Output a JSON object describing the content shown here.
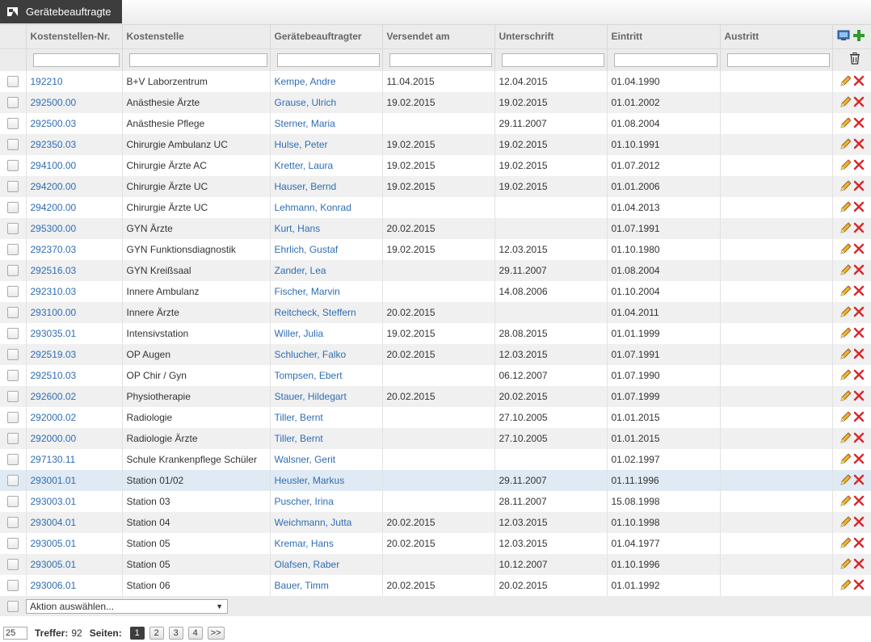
{
  "tab": {
    "label": "Gerätebeauftragte"
  },
  "columns": [
    "Kostenstellen-Nr.",
    "Kostenstelle",
    "Gerätebeauftragter",
    "Versendet am",
    "Unterschrift",
    "Eintritt",
    "Austritt"
  ],
  "rows": [
    {
      "nr": "192210",
      "ks": "B+V Laborzentrum",
      "gb": "Kempe, Andre",
      "vers": "11.04.2015",
      "unt": "12.04.2015",
      "ein": "01.04.1990",
      "aus": ""
    },
    {
      "nr": "292500.00",
      "ks": "Anästhesie Ärzte",
      "gb": "Grause, Ulrich",
      "vers": "19.02.2015",
      "unt": "19.02.2015",
      "ein": "01.01.2002",
      "aus": ""
    },
    {
      "nr": "292500.03",
      "ks": "Anästhesie Pflege",
      "gb": "Sterner, Maria",
      "vers": "",
      "unt": "29.11.2007",
      "ein": "01.08.2004",
      "aus": ""
    },
    {
      "nr": "292350.03",
      "ks": "Chirurgie Ambulanz UC",
      "gb": "Hulse, Peter",
      "vers": "19.02.2015",
      "unt": "19.02.2015",
      "ein": "01.10.1991",
      "aus": ""
    },
    {
      "nr": "294100.00",
      "ks": "Chirurgie Ärzte AC",
      "gb": "Kretter, Laura",
      "vers": "19.02.2015",
      "unt": "19.02.2015",
      "ein": "01.07.2012",
      "aus": ""
    },
    {
      "nr": "294200.00",
      "ks": "Chirurgie Ärzte UC",
      "gb": "Hauser, Bernd",
      "vers": "19.02.2015",
      "unt": "19.02.2015",
      "ein": "01.01.2006",
      "aus": ""
    },
    {
      "nr": "294200.00",
      "ks": "Chirurgie Ärzte UC",
      "gb": "Lehmann, Konrad",
      "vers": "",
      "unt": "",
      "ein": "01.04.2013",
      "aus": ""
    },
    {
      "nr": "295300.00",
      "ks": "GYN Ärzte",
      "gb": "Kurt, Hans",
      "vers": "20.02.2015",
      "unt": "",
      "ein": "01.07.1991",
      "aus": ""
    },
    {
      "nr": "292370.03",
      "ks": "GYN Funktionsdiagnostik",
      "gb": "Ehrlich, Gustaf",
      "vers": "19.02.2015",
      "unt": "12.03.2015",
      "ein": "01.10.1980",
      "aus": ""
    },
    {
      "nr": "292516.03",
      "ks": "GYN Kreißsaal",
      "gb": "Zander, Lea",
      "vers": "",
      "unt": "29.11.2007",
      "ein": "01.08.2004",
      "aus": ""
    },
    {
      "nr": "292310.03",
      "ks": "Innere Ambulanz",
      "gb": "Fischer, Marvin",
      "vers": "",
      "unt": "14.08.2006",
      "ein": "01.10.2004",
      "aus": ""
    },
    {
      "nr": "293100.00",
      "ks": "Innere Ärzte",
      "gb": "Reitcheck, Steffern",
      "vers": "20.02.2015",
      "unt": "",
      "ein": "01.04.2011",
      "aus": ""
    },
    {
      "nr": "293035.01",
      "ks": "Intensivstation",
      "gb": "Willer, Julia",
      "vers": "19.02.2015",
      "unt": "28.08.2015",
      "ein": "01.01.1999",
      "aus": ""
    },
    {
      "nr": "292519.03",
      "ks": "OP Augen",
      "gb": "Schlucher, Falko",
      "vers": "20.02.2015",
      "unt": "12.03.2015",
      "ein": "01.07.1991",
      "aus": ""
    },
    {
      "nr": "292510.03",
      "ks": "OP Chir / Gyn",
      "gb": "Tompsen, Ebert",
      "vers": "",
      "unt": "06.12.2007",
      "ein": "01.07.1990",
      "aus": ""
    },
    {
      "nr": "292600.02",
      "ks": "Physiotherapie",
      "gb": "Stauer, Hildegart",
      "vers": "20.02.2015",
      "unt": "20.02.2015",
      "ein": "01.07.1999",
      "aus": ""
    },
    {
      "nr": "292000.02",
      "ks": "Radiologie",
      "gb": "Tiller, Bernt",
      "vers": "",
      "unt": "27.10.2005",
      "ein": "01.01.2015",
      "aus": ""
    },
    {
      "nr": "292000.00",
      "ks": "Radiologie Ärzte",
      "gb": "Tiller, Bernt",
      "vers": "",
      "unt": "27.10.2005",
      "ein": "01.01.2015",
      "aus": ""
    },
    {
      "nr": "297130.11",
      "ks": "Schule Krankenpflege Schüler",
      "gb": "Walsner, Gerit",
      "vers": "",
      "unt": "",
      "ein": "01.02.1997",
      "aus": ""
    },
    {
      "nr": "293001.01",
      "ks": "Station 01/02",
      "gb": "Heusler, Markus",
      "vers": "",
      "unt": "29.11.2007",
      "ein": "01.11.1996",
      "aus": "",
      "hl": true
    },
    {
      "nr": "293003.01",
      "ks": "Station 03",
      "gb": "Puscher, Irina",
      "vers": "",
      "unt": "28.11.2007",
      "ein": "15.08.1998",
      "aus": ""
    },
    {
      "nr": "293004.01",
      "ks": "Station 04",
      "gb": "Weichmann, Jutta",
      "vers": "20.02.2015",
      "unt": "12.03.2015",
      "ein": "01.10.1998",
      "aus": ""
    },
    {
      "nr": "293005.01",
      "ks": "Station 05",
      "gb": "Kremar, Hans",
      "vers": "20.02.2015",
      "unt": "12.03.2015",
      "ein": "01.04.1977",
      "aus": ""
    },
    {
      "nr": "293005.01",
      "ks": "Station 05",
      "gb": "Olafsen, Raber",
      "vers": "",
      "unt": "10.12.2007",
      "ein": "01.10.1996",
      "aus": ""
    },
    {
      "nr": "293006.01",
      "ks": "Station 06",
      "gb": "Bauer, Timm",
      "vers": "20.02.2015",
      "unt": "20.02.2015",
      "ein": "01.01.1992",
      "aus": ""
    }
  ],
  "action_select": {
    "value": "Aktion auswählen..."
  },
  "pager": {
    "per_page": "25",
    "hits_label": "Treffer:",
    "hits": "92",
    "pages_label": "Seiten:",
    "pages": [
      "1",
      "2",
      "3",
      "4"
    ],
    "current": "1",
    "next": ">>"
  },
  "colors": {
    "link": "#2f6db5",
    "tab_bg": "#3d3d3d",
    "delete": "#d9262b",
    "add": "#2e9b2e"
  }
}
